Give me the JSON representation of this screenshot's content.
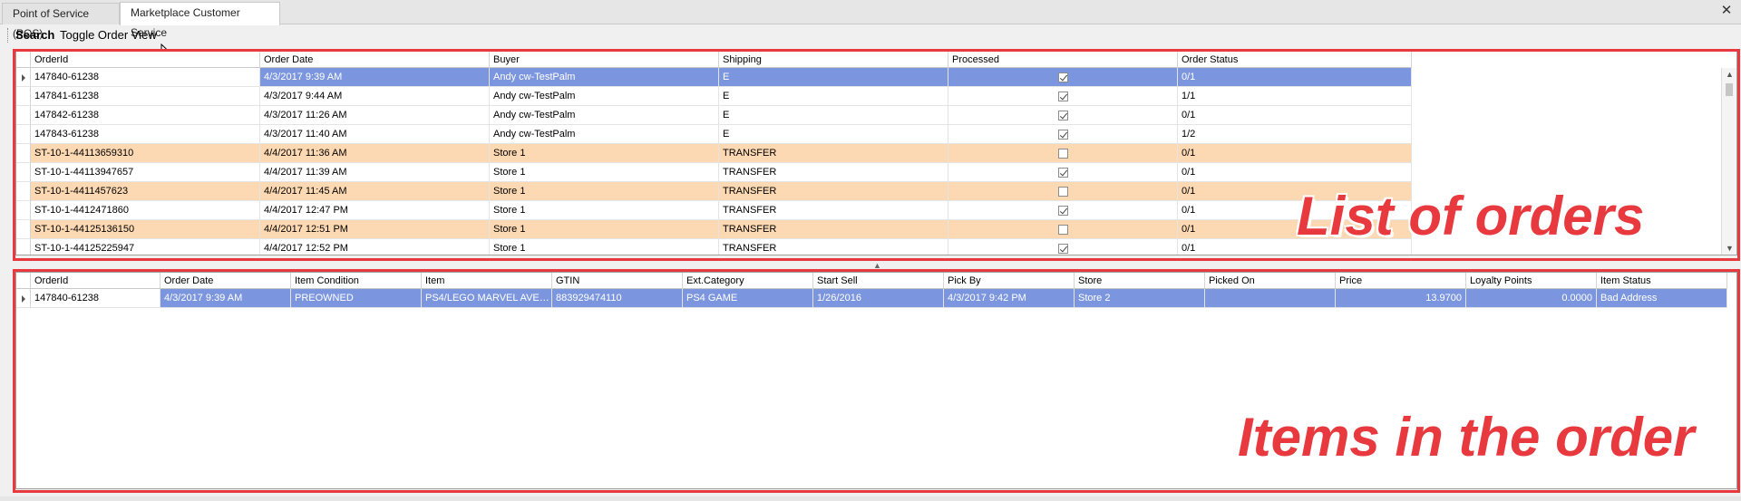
{
  "tabs": [
    {
      "label": "Point of Service (POS)",
      "active": false
    },
    {
      "label": "Marketplace Customer Service",
      "active": true
    }
  ],
  "toolbar": {
    "search_label": "Search",
    "toggle_label": "Toggle Order View"
  },
  "orders": {
    "columns": [
      "OrderId",
      "Order Date",
      "Buyer",
      "Shipping",
      "Processed",
      "Order Status"
    ],
    "rows": [
      {
        "OrderId": "147840-61238",
        "OrderDate": "4/3/2017 9:39 AM",
        "Buyer": "Andy cw-TestPalm",
        "Shipping": "E",
        "Processed": true,
        "OrderStatus": "0/1",
        "selected": true,
        "highlight": false
      },
      {
        "OrderId": "147841-61238",
        "OrderDate": "4/3/2017 9:44 AM",
        "Buyer": "Andy cw-TestPalm",
        "Shipping": "E",
        "Processed": true,
        "OrderStatus": "1/1",
        "selected": false,
        "highlight": false
      },
      {
        "OrderId": "147842-61238",
        "OrderDate": "4/3/2017 11:26 AM",
        "Buyer": "Andy cw-TestPalm",
        "Shipping": "E",
        "Processed": true,
        "OrderStatus": "0/1",
        "selected": false,
        "highlight": false
      },
      {
        "OrderId": "147843-61238",
        "OrderDate": "4/3/2017 11:40 AM",
        "Buyer": "Andy cw-TestPalm",
        "Shipping": "E",
        "Processed": true,
        "OrderStatus": "1/2",
        "selected": false,
        "highlight": false
      },
      {
        "OrderId": "ST-10-1-44113659310",
        "OrderDate": "4/4/2017 11:36 AM",
        "Buyer": "Store 1",
        "Shipping": "TRANSFER",
        "Processed": false,
        "OrderStatus": "0/1",
        "selected": false,
        "highlight": true
      },
      {
        "OrderId": "ST-10-1-44113947657",
        "OrderDate": "4/4/2017 11:39 AM",
        "Buyer": "Store 1",
        "Shipping": "TRANSFER",
        "Processed": true,
        "OrderStatus": "0/1",
        "selected": false,
        "highlight": false
      },
      {
        "OrderId": "ST-10-1-4411457623",
        "OrderDate": "4/4/2017 11:45 AM",
        "Buyer": "Store 1",
        "Shipping": "TRANSFER",
        "Processed": false,
        "OrderStatus": "0/1",
        "selected": false,
        "highlight": true
      },
      {
        "OrderId": "ST-10-1-4412471860",
        "OrderDate": "4/4/2017 12:47 PM",
        "Buyer": "Store 1",
        "Shipping": "TRANSFER",
        "Processed": true,
        "OrderStatus": "0/1",
        "selected": false,
        "highlight": false
      },
      {
        "OrderId": "ST-10-1-44125136150",
        "OrderDate": "4/4/2017 12:51 PM",
        "Buyer": "Store 1",
        "Shipping": "TRANSFER",
        "Processed": false,
        "OrderStatus": "0/1",
        "selected": false,
        "highlight": true
      },
      {
        "OrderId": "ST-10-1-44125225947",
        "OrderDate": "4/4/2017 12:52 PM",
        "Buyer": "Store 1",
        "Shipping": "TRANSFER",
        "Processed": true,
        "OrderStatus": "0/1",
        "selected": false,
        "highlight": false
      }
    ]
  },
  "items": {
    "columns": [
      "OrderId",
      "Order Date",
      "Item Condition",
      "Item",
      "GTIN",
      "Ext.Category",
      "Start Sell",
      "Pick By",
      "Store",
      "Picked On",
      "Price",
      "Loyalty Points",
      "Item Status"
    ],
    "rows": [
      {
        "OrderId": "147840-61238",
        "OrderDate": "4/3/2017 9:39 AM",
        "ItemCondition": "PREOWNED",
        "Item": "PS4/LEGO MARVEL AVEN...",
        "GTIN": "883929474110",
        "ExtCategory": "PS4 GAME",
        "StartSell": "1/26/2016",
        "PickBy": "4/3/2017 9:42 PM",
        "Store": "Store 2",
        "PickedOn": "",
        "Price": "13.9700",
        "LoyaltyPoints": "0.0000",
        "ItemStatus": "Bad Address",
        "selected": true
      }
    ]
  },
  "annotations": {
    "orders_label": "List of orders",
    "items_label": "Items in the order",
    "color": "#e8393e"
  },
  "colors": {
    "selected": "#7b96de",
    "highlight": "#fdd9b3"
  }
}
